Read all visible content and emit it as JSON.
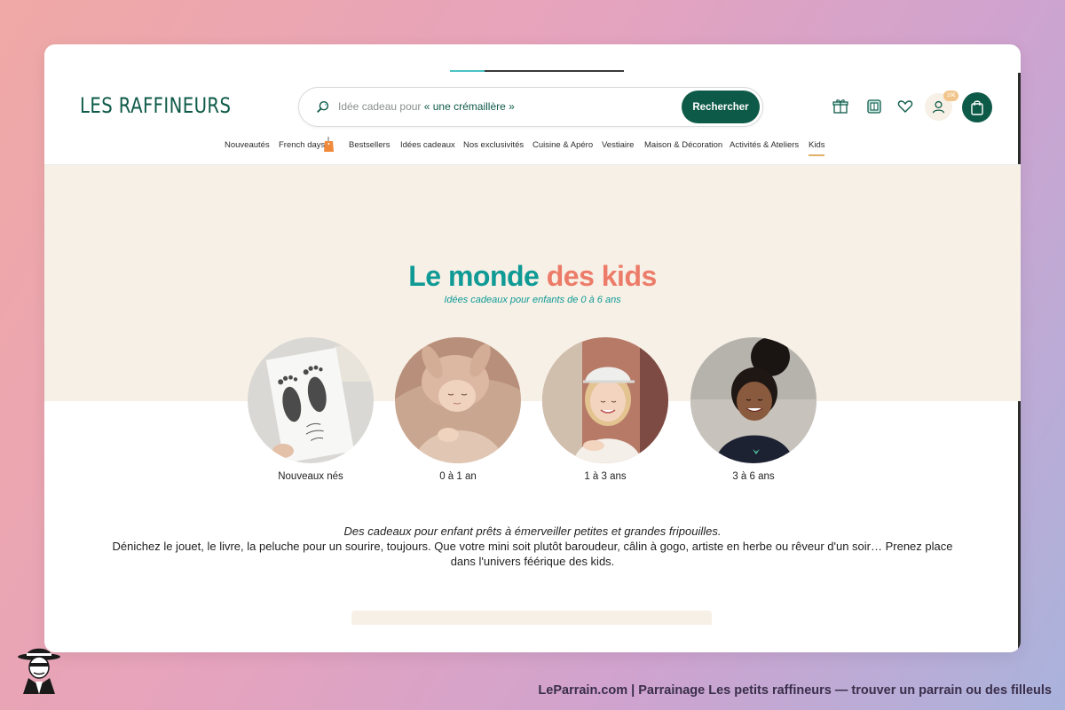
{
  "header": {
    "logo": "LES RAFFINEURS",
    "search_placeholder_prefix": "Idée cadeau pour ",
    "search_placeholder_highlight": "« une crémaillère »",
    "search_button": "Rechercher",
    "account_badge": "10€",
    "progress": 0.2
  },
  "nav": {
    "items": [
      "Nouveautés",
      "French days",
      "Bestsellers",
      "Idées cadeaux",
      "Nos exclusivités",
      "Cuisine & Apéro",
      "Vestiaire",
      "Maison & Décoration",
      "Activités & Ateliers",
      "Kids"
    ],
    "active": "Kids"
  },
  "hero": {
    "title_part1": "Le monde",
    "title_part2": "des kids",
    "subtitle": "Idées cadeaux pour enfants de 0 à 6 ans"
  },
  "categories": [
    {
      "label": "Nouveaux nés"
    },
    {
      "label": "0 à 1 an"
    },
    {
      "label": "1 à 3 ans"
    },
    {
      "label": "3 à 6 ans"
    }
  ],
  "description": {
    "lead": "Des cadeaux pour enfant prêts à émerveiller petites et grandes fripouilles.",
    "body": "Dénichez le jouet, le livre, la peluche pour un sourire, toujours. Que votre mini soit plutôt baroudeur, câlin à gogo, artiste en herbe ou rêveur d'un soir… Prenez place dans l'univers féérique des kids."
  },
  "footer_caption": "LeParrain.com | Parrainage Les petits raffineurs — trouver un parrain ou des filleuls",
  "colors": {
    "brand_green": "#0e5a48",
    "teal": "#0f9a96",
    "coral": "#ec7c69",
    "cream": "#f7f0e6",
    "accent_gold": "#e0b167"
  }
}
